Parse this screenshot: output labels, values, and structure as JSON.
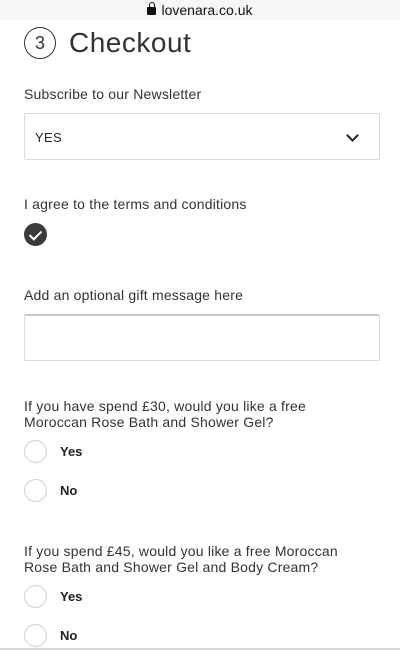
{
  "browser": {
    "url": "lovenara.co.uk"
  },
  "checkout": {
    "step_number": "3",
    "title": "Checkout"
  },
  "newsletter": {
    "label": "Subscribe to our Newsletter",
    "selected": "YES"
  },
  "terms": {
    "label": "I agree to the terms and conditions",
    "checked": true
  },
  "gift_message": {
    "label": "Add an optional gift message here",
    "value": ""
  },
  "offer_30": {
    "question_line1": "If you have spend £30, would you like a free",
    "question_line2": "Moroccan Rose Bath and Shower Gel?",
    "options": [
      "Yes",
      "No"
    ]
  },
  "offer_45": {
    "question_line1": "If you spend £45, would you like a free Moroccan",
    "question_line2": "Rose Bath and Shower Gel and Body Cream?",
    "options": [
      "Yes",
      "No"
    ]
  }
}
